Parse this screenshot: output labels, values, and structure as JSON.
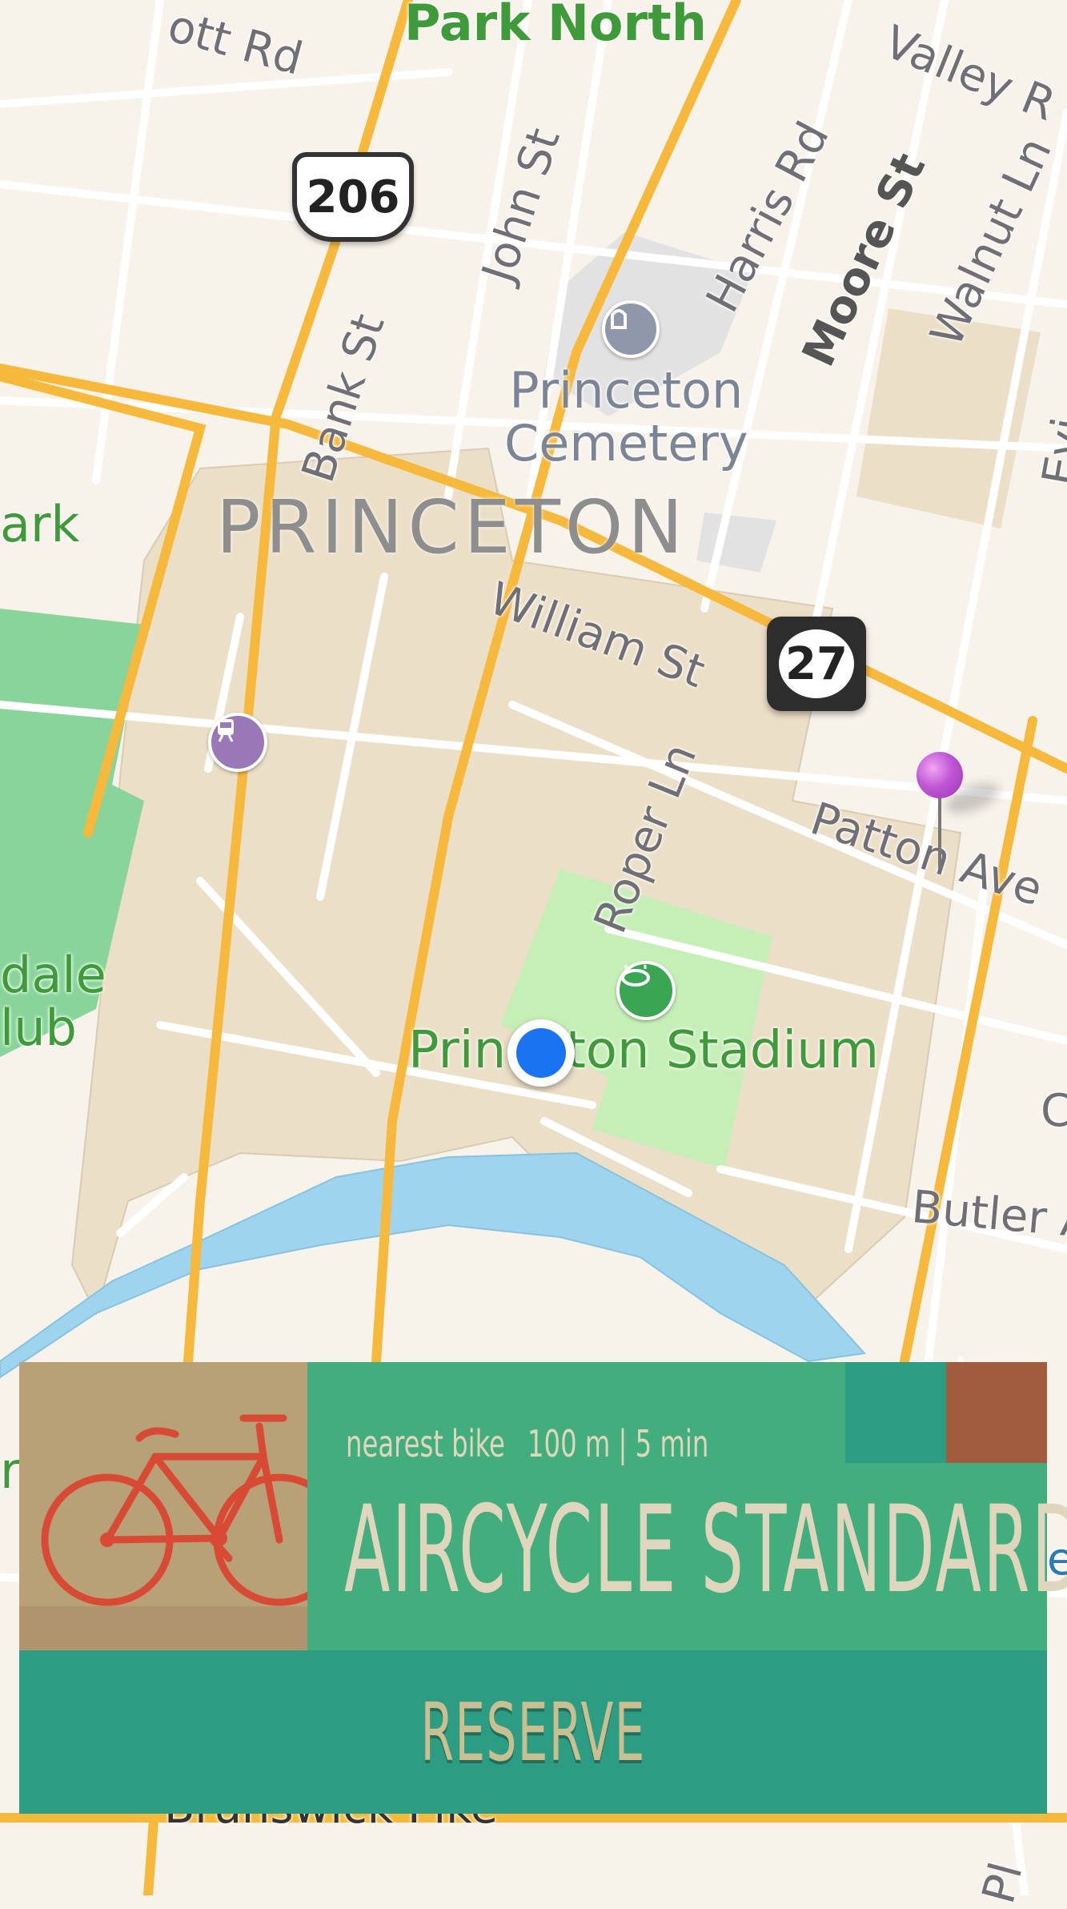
{
  "map": {
    "labels": {
      "park_north": "Park North",
      "valley": "Valley R",
      "ott_rd": "ott Rd",
      "john_st": "John St",
      "harris_rd": "Harris Rd",
      "moore_st": "Moore St",
      "walnut_ln": "Walnut Ln",
      "bank_st": "Bank St",
      "princeton_cemetery": "Princeton\nCemetery",
      "city": "PRINCETON",
      "william_st": "William St",
      "roper_ln": "Roper Ln",
      "patton_ave": "Patton Ave",
      "butler": "Butler A",
      "stadium": "Princeton Stadium",
      "ark": "ark",
      "dale_club": "dale\nlub",
      "brunswick_pike": "Brunswick Pike",
      "evi": "Evi",
      "pl": "Pl",
      "edge_c": "C",
      "edge_r": "r",
      "edge_e": "e"
    },
    "shields": {
      "us_route": "206",
      "state_route": "27"
    },
    "colors": {
      "land": "#f7f2ea",
      "campus": "#ebdfc7",
      "park": "#88d49a",
      "stadium_field": "#c6efb8",
      "water": "#9fd4ef",
      "major_road": "#f6b93b",
      "user_location": "#1a73f0",
      "pin": "#c056d6"
    },
    "icons": {
      "cemetery": "cemetery-icon",
      "train": "train-station-icon",
      "stadium": "stadium-icon",
      "location": "user-location-icon",
      "pin": "dropped-pin-icon"
    }
  },
  "card": {
    "nearest_label": "nearest bike",
    "distance": "100 m | 5 min",
    "bike_name": "AIRCYCLE STANDARD",
    "reserve_label": "RESERVE",
    "bike_icon": "bicycle-icon",
    "colors": {
      "card_green": "#43ae7d",
      "reserve_teal": "#2c9d82",
      "tile_tan": "#b8a077",
      "swatch_teal": "#2c9d82",
      "swatch_brown": "#a15b3e",
      "bike_red": "#d94a35",
      "text_cream": "#dfd6bd"
    }
  }
}
